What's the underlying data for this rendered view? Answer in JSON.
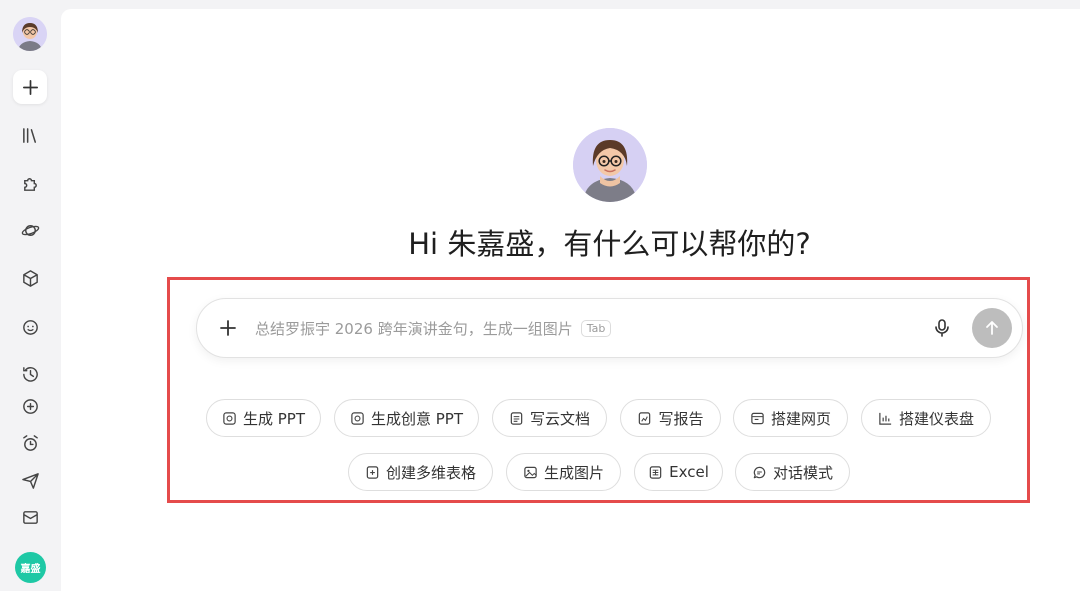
{
  "sidebar": {
    "user_badge": "嘉盛",
    "items": [
      {
        "name": "new-chat",
        "icon": "plus-icon"
      },
      {
        "name": "library",
        "icon": "books-icon"
      },
      {
        "name": "plugins",
        "icon": "puzzle-icon"
      },
      {
        "name": "explore",
        "icon": "planet-icon"
      },
      {
        "name": "models",
        "icon": "cube-icon"
      },
      {
        "name": "agents",
        "icon": "smiley-icon"
      },
      {
        "name": "history",
        "icon": "history-icon"
      },
      {
        "name": "add",
        "icon": "plus-circle-icon"
      },
      {
        "name": "schedule",
        "icon": "alarm-icon"
      },
      {
        "name": "send",
        "icon": "paper-plane-icon"
      },
      {
        "name": "mail",
        "icon": "mail-icon"
      }
    ]
  },
  "main": {
    "greeting": "Hi 朱嘉盛，有什么可以帮你的?",
    "input": {
      "placeholder": "总结罗振宇 2026 跨年演讲金句，生成一组图片",
      "tab_hint": "Tab"
    },
    "chips_row1": [
      {
        "label": "生成 PPT",
        "icon": "ppt-icon"
      },
      {
        "label": "生成创意 PPT",
        "icon": "ppt-creative-icon"
      },
      {
        "label": "写云文档",
        "icon": "doc-icon"
      },
      {
        "label": "写报告",
        "icon": "report-icon"
      },
      {
        "label": "搭建网页",
        "icon": "webpage-icon"
      },
      {
        "label": "搭建仪表盘",
        "icon": "dashboard-icon"
      }
    ],
    "chips_row2": [
      {
        "label": "创建多维表格",
        "icon": "table-icon"
      },
      {
        "label": "生成图片",
        "icon": "image-icon"
      },
      {
        "label": "Excel",
        "icon": "excel-icon"
      },
      {
        "label": "对话模式",
        "icon": "chat-icon"
      }
    ]
  }
}
